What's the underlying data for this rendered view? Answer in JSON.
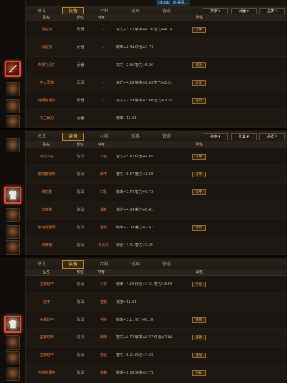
{
  "top_info": "[未加载] 庞·寨情...",
  "tabs": [
    "总览",
    "装备",
    "材料",
    "道具",
    "管道"
  ],
  "dropdowns": [
    "排序",
    "武器",
    "品质"
  ],
  "dropdowns_armor": [
    "排序",
    "防具",
    "品质"
  ],
  "columns": [
    "品名",
    "部位",
    "特有",
    "",
    "",
    "",
    "属性"
  ],
  "panel1": {
    "rows": [
      {
        "name": "青钰剑",
        "cat": "武器",
        "pos": "--",
        "attrs": "攻力+3.73  敏率+4.26  智力+4.14",
        "badge": "淬甲"
      },
      {
        "name": "青钰剑",
        "cat": "武器",
        "pos": "--",
        "attrs": "敏率+4.34  体治+7.23",
        "badge": ""
      },
      {
        "name": "奔腾飞月刀",
        "cat": "武器",
        "pos": "--",
        "attrs": "攻力+2.86  智力+5.26",
        "badge": "无双"
      },
      {
        "name": "古大里轴",
        "cat": "武器",
        "pos": "--",
        "attrs": "攻力+4.28  敏率+2.63  智力+2.31",
        "badge": "奔里"
      },
      {
        "name": "雄纲宽阔剑",
        "cat": "武器",
        "pos": "--",
        "attrs": "攻力+2.59  敏率+3.60  智力+3.35",
        "badge": "强幻"
      },
      {
        "name": "令主寶刀",
        "cat": "武器",
        "pos": "--",
        "attrs": "敏率+12.08",
        "badge": ""
      }
    ]
  },
  "panel2": {
    "rows": [
      {
        "name": "河滨白衣",
        "cat": "防具",
        "pos": "华装",
        "attrs": "智力+5.42  体治+4.65",
        "badge": "淬甲"
      },
      {
        "name": "宏宏龍蝎甲",
        "cat": "防具",
        "pos": "胸甲",
        "attrs": "智力+8.67  魅力+3.50",
        "badge": "淬甲"
      },
      {
        "name": "绕蛇靴",
        "cat": "防具",
        "pos": "石靴",
        "attrs": "敏率+3.75  智力+7.73",
        "badge": "淬甲"
      },
      {
        "name": "天璜靴",
        "cat": "防具",
        "pos": "長靴",
        "attrs": "体治+4.04  魅力+6.61",
        "badge": ""
      },
      {
        "name": "歌海遗彈頭",
        "cat": "防具",
        "pos": "猫刺",
        "attrs": "敏率+2.08  魅力+7.47",
        "badge": "无体"
      },
      {
        "name": "天璜靴",
        "cat": "防具",
        "pos": "石長靴",
        "attrs": "体治+4.41  智力+7.35",
        "badge": ""
      }
    ]
  },
  "panel3": {
    "rows": [
      {
        "name": "宝锈虹甲",
        "cat": "防具",
        "pos": "洞衣",
        "attrs": "敏率+4.50  体治+4.31  智力+3.50",
        "badge": "河泉"
      },
      {
        "name": "古甲",
        "cat": "防具",
        "pos": "皇錯",
        "attrs": "速度+12.09",
        "badge": ""
      },
      {
        "name": "宝锈虹甲",
        "cat": "防具",
        "pos": "谷裝",
        "attrs": "敏率+3.11  智力+8.10",
        "badge": "重射"
      },
      {
        "name": "宝锈虹甲",
        "cat": "防具",
        "pos": "胸甲",
        "attrs": "智力+4.73  敏率+4.57  体治+2.04",
        "badge": "重射"
      },
      {
        "name": "宝锈虹甲",
        "cat": "防具",
        "pos": "雪装",
        "attrs": "智力+8.21  体治+4.23",
        "badge": "重射"
      },
      {
        "name": "古链遗理甲",
        "cat": "防具",
        "pos": "披藏",
        "attrs": "敏率+9.68  速度+3.73",
        "badge": "闪敏"
      }
    ]
  },
  "colors": {
    "accent": "#f0c060",
    "item_name": "#e2793a",
    "selected_border": "#e0483a"
  }
}
